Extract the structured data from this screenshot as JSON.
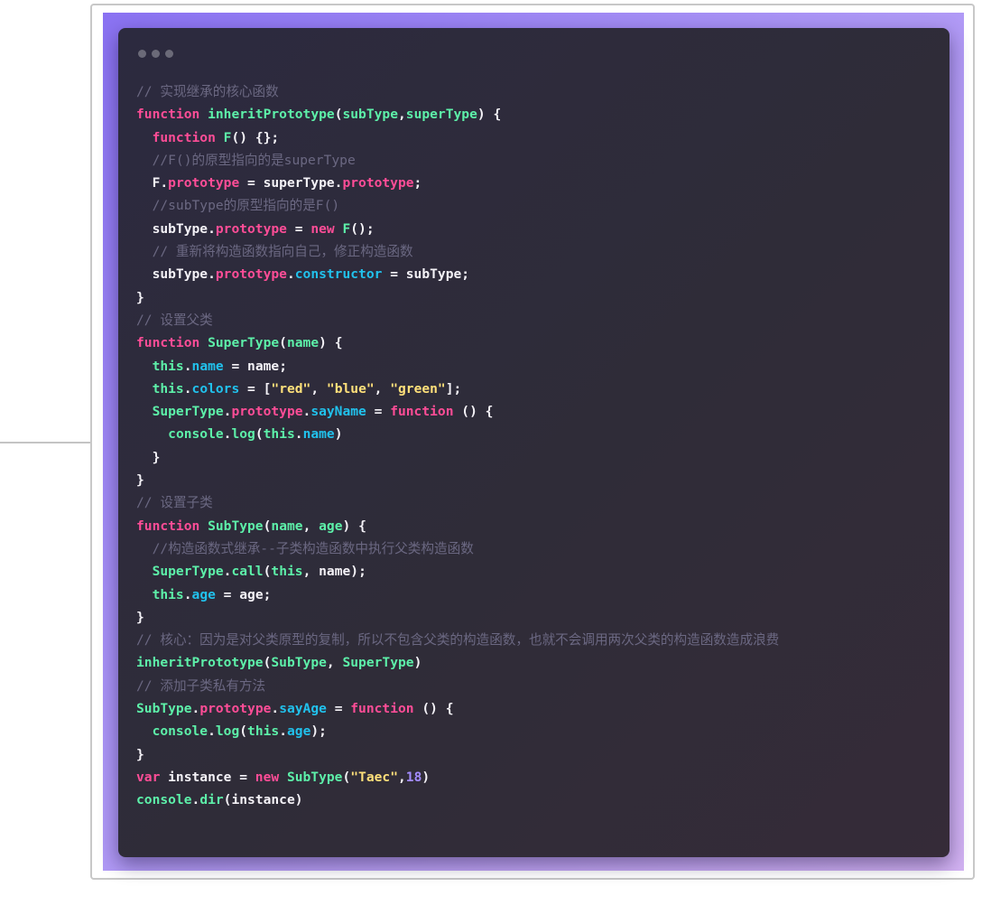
{
  "window": {
    "title_dots": [
      "dot",
      "dot",
      "dot"
    ]
  },
  "colors": {
    "keyword": "#ff4d97",
    "function_name": "#5df0a9",
    "property_cyan": "#21c1ec",
    "string": "#ffe07a",
    "number": "#a38cff",
    "comment": "#6b6882",
    "text": "#f4f2f7"
  },
  "code_lines": [
    [
      {
        "t": "// 实现继承的核心函数",
        "c": "cm"
      }
    ],
    [
      {
        "t": "function",
        "c": "kw"
      },
      {
        "t": " ",
        "c": "tx"
      },
      {
        "t": "inheritPrototype",
        "c": "fn"
      },
      {
        "t": "(",
        "c": "tx"
      },
      {
        "t": "subType",
        "c": "fn"
      },
      {
        "t": ",",
        "c": "tx"
      },
      {
        "t": "superType",
        "c": "fn"
      },
      {
        "t": ") {",
        "c": "tx"
      }
    ],
    [
      {
        "t": "  ",
        "c": "tx"
      },
      {
        "t": "function",
        "c": "kw"
      },
      {
        "t": " ",
        "c": "tx"
      },
      {
        "t": "F",
        "c": "fn"
      },
      {
        "t": "() {};",
        "c": "tx"
      }
    ],
    [
      {
        "t": "  //F()的原型指向的是superType",
        "c": "cm"
      }
    ],
    [
      {
        "t": "  F.",
        "c": "tx"
      },
      {
        "t": "prototype",
        "c": "pr"
      },
      {
        "t": " = superType.",
        "c": "tx"
      },
      {
        "t": "prototype",
        "c": "pr"
      },
      {
        "t": ";",
        "c": "tx"
      }
    ],
    [
      {
        "t": "  //subType的原型指向的是F()",
        "c": "cm"
      }
    ],
    [
      {
        "t": "  subType.",
        "c": "tx"
      },
      {
        "t": "prototype",
        "c": "pr"
      },
      {
        "t": " = ",
        "c": "tx"
      },
      {
        "t": "new",
        "c": "kw"
      },
      {
        "t": " ",
        "c": "tx"
      },
      {
        "t": "F",
        "c": "fn"
      },
      {
        "t": "();",
        "c": "tx"
      }
    ],
    [
      {
        "t": "  // 重新将构造函数指向自己，修正构造函数",
        "c": "cm"
      }
    ],
    [
      {
        "t": "  subType.",
        "c": "tx"
      },
      {
        "t": "prototype",
        "c": "pr"
      },
      {
        "t": ".",
        "c": "tx"
      },
      {
        "t": "constructor",
        "c": "cy"
      },
      {
        "t": " = subType;",
        "c": "tx"
      }
    ],
    [
      {
        "t": "}",
        "c": "tx"
      }
    ],
    [
      {
        "t": "// 设置父类",
        "c": "cm"
      }
    ],
    [
      {
        "t": "function",
        "c": "kw"
      },
      {
        "t": " ",
        "c": "tx"
      },
      {
        "t": "SuperType",
        "c": "fn"
      },
      {
        "t": "(",
        "c": "tx"
      },
      {
        "t": "name",
        "c": "fn"
      },
      {
        "t": ") {",
        "c": "tx"
      }
    ],
    [
      {
        "t": "  ",
        "c": "tx"
      },
      {
        "t": "this",
        "c": "fn"
      },
      {
        "t": ".",
        "c": "tx"
      },
      {
        "t": "name",
        "c": "cy"
      },
      {
        "t": " = name;",
        "c": "tx"
      }
    ],
    [
      {
        "t": "  ",
        "c": "tx"
      },
      {
        "t": "this",
        "c": "fn"
      },
      {
        "t": ".",
        "c": "tx"
      },
      {
        "t": "colors",
        "c": "cy"
      },
      {
        "t": " = [",
        "c": "tx"
      },
      {
        "t": "\"red\"",
        "c": "st"
      },
      {
        "t": ", ",
        "c": "tx"
      },
      {
        "t": "\"blue\"",
        "c": "st"
      },
      {
        "t": ", ",
        "c": "tx"
      },
      {
        "t": "\"green\"",
        "c": "st"
      },
      {
        "t": "];",
        "c": "tx"
      }
    ],
    [
      {
        "t": "  ",
        "c": "tx"
      },
      {
        "t": "SuperType",
        "c": "fn"
      },
      {
        "t": ".",
        "c": "tx"
      },
      {
        "t": "prototype",
        "c": "pr"
      },
      {
        "t": ".",
        "c": "tx"
      },
      {
        "t": "sayName",
        "c": "cy"
      },
      {
        "t": " = ",
        "c": "tx"
      },
      {
        "t": "function",
        "c": "kw"
      },
      {
        "t": " () {",
        "c": "tx"
      }
    ],
    [
      {
        "t": "    ",
        "c": "tx"
      },
      {
        "t": "console",
        "c": "fn"
      },
      {
        "t": ".",
        "c": "tx"
      },
      {
        "t": "log",
        "c": "fn"
      },
      {
        "t": "(",
        "c": "tx"
      },
      {
        "t": "this",
        "c": "fn"
      },
      {
        "t": ".",
        "c": "tx"
      },
      {
        "t": "name",
        "c": "cy"
      },
      {
        "t": ")",
        "c": "tx"
      }
    ],
    [
      {
        "t": "  }",
        "c": "tx"
      }
    ],
    [
      {
        "t": "}",
        "c": "tx"
      }
    ],
    [
      {
        "t": "// 设置子类",
        "c": "cm"
      }
    ],
    [
      {
        "t": "function",
        "c": "kw"
      },
      {
        "t": " ",
        "c": "tx"
      },
      {
        "t": "SubType",
        "c": "fn"
      },
      {
        "t": "(",
        "c": "tx"
      },
      {
        "t": "name",
        "c": "fn"
      },
      {
        "t": ", ",
        "c": "tx"
      },
      {
        "t": "age",
        "c": "fn"
      },
      {
        "t": ") {",
        "c": "tx"
      }
    ],
    [
      {
        "t": "  //构造函数式继承--子类构造函数中执行父类构造函数",
        "c": "cm"
      }
    ],
    [
      {
        "t": "  ",
        "c": "tx"
      },
      {
        "t": "SuperType",
        "c": "fn"
      },
      {
        "t": ".",
        "c": "tx"
      },
      {
        "t": "call",
        "c": "fn"
      },
      {
        "t": "(",
        "c": "tx"
      },
      {
        "t": "this",
        "c": "fn"
      },
      {
        "t": ", name);",
        "c": "tx"
      }
    ],
    [
      {
        "t": "  ",
        "c": "tx"
      },
      {
        "t": "this",
        "c": "fn"
      },
      {
        "t": ".",
        "c": "tx"
      },
      {
        "t": "age",
        "c": "cy"
      },
      {
        "t": " = age;",
        "c": "tx"
      }
    ],
    [
      {
        "t": "}",
        "c": "tx"
      }
    ],
    [
      {
        "t": "// 核心：因为是对父类原型的复制，所以不包含父类的构造函数，也就不会调用两次父类的构造函数造成浪费",
        "c": "cm"
      }
    ],
    [
      {
        "t": "inheritPrototype",
        "c": "fn"
      },
      {
        "t": "(",
        "c": "tx"
      },
      {
        "t": "SubType",
        "c": "fn"
      },
      {
        "t": ", ",
        "c": "tx"
      },
      {
        "t": "SuperType",
        "c": "fn"
      },
      {
        "t": ")",
        "c": "tx"
      }
    ],
    [
      {
        "t": "// 添加子类私有方法",
        "c": "cm"
      }
    ],
    [
      {
        "t": "SubType",
        "c": "fn"
      },
      {
        "t": ".",
        "c": "tx"
      },
      {
        "t": "prototype",
        "c": "pr"
      },
      {
        "t": ".",
        "c": "tx"
      },
      {
        "t": "sayAge",
        "c": "cy"
      },
      {
        "t": " = ",
        "c": "tx"
      },
      {
        "t": "function",
        "c": "kw"
      },
      {
        "t": " () {",
        "c": "tx"
      }
    ],
    [
      {
        "t": "  ",
        "c": "tx"
      },
      {
        "t": "console",
        "c": "fn"
      },
      {
        "t": ".",
        "c": "tx"
      },
      {
        "t": "log",
        "c": "fn"
      },
      {
        "t": "(",
        "c": "tx"
      },
      {
        "t": "this",
        "c": "fn"
      },
      {
        "t": ".",
        "c": "tx"
      },
      {
        "t": "age",
        "c": "cy"
      },
      {
        "t": ");",
        "c": "tx"
      }
    ],
    [
      {
        "t": "}",
        "c": "tx"
      }
    ],
    [
      {
        "t": "var",
        "c": "kw"
      },
      {
        "t": " instance = ",
        "c": "tx"
      },
      {
        "t": "new",
        "c": "kw"
      },
      {
        "t": " ",
        "c": "tx"
      },
      {
        "t": "SubType",
        "c": "fn"
      },
      {
        "t": "(",
        "c": "tx"
      },
      {
        "t": "\"Taec\"",
        "c": "st"
      },
      {
        "t": ",",
        "c": "tx"
      },
      {
        "t": "18",
        "c": "nu"
      },
      {
        "t": ")",
        "c": "tx"
      }
    ],
    [
      {
        "t": "console",
        "c": "fn"
      },
      {
        "t": ".",
        "c": "tx"
      },
      {
        "t": "dir",
        "c": "fn"
      },
      {
        "t": "(instance)",
        "c": "tx"
      }
    ]
  ]
}
